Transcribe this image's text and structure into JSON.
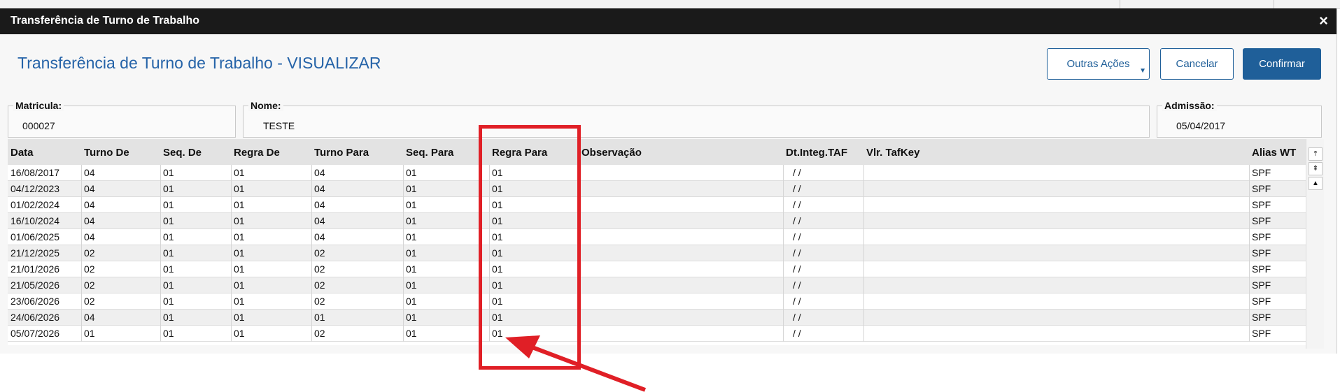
{
  "window": {
    "title": "Transferência de Turno de Trabalho",
    "close_glyph": "×"
  },
  "page": {
    "heading": "Transferência de Turno de Trabalho - VISUALIZAR"
  },
  "actions": {
    "other_label": "Outras Ações",
    "cancel_label": "Cancelar",
    "confirm_label": "Confirmar"
  },
  "fields": {
    "matricula": {
      "label": "Matricula:",
      "value": "000027"
    },
    "nome": {
      "label": "Nome:",
      "value": "TESTE"
    },
    "admissao": {
      "label": "Admissão:",
      "value": "05/04/2017"
    }
  },
  "table": {
    "columns": [
      "Data",
      "Turno De",
      "Seq. De",
      "Regra De",
      "Turno Para",
      "Seq. Para",
      "Regra Para",
      "Observação",
      "Dt.Integ.TAF",
      "Vlr. TafKey",
      "Alias WT"
    ],
    "rows": [
      [
        "16/08/2017",
        "04",
        "01",
        "01",
        "04",
        "01",
        "01",
        "",
        "/ /",
        "",
        "SPF"
      ],
      [
        "04/12/2023",
        "04",
        "01",
        "01",
        "04",
        "01",
        "01",
        "",
        "/ /",
        "",
        "SPF"
      ],
      [
        "01/02/2024",
        "04",
        "01",
        "01",
        "04",
        "01",
        "01",
        "",
        "/ /",
        "",
        "SPF"
      ],
      [
        "16/10/2024",
        "04",
        "01",
        "01",
        "04",
        "01",
        "01",
        "",
        "/ /",
        "",
        "SPF"
      ],
      [
        "01/06/2025",
        "04",
        "01",
        "01",
        "04",
        "01",
        "01",
        "",
        "/ /",
        "",
        "SPF"
      ],
      [
        "21/12/2025",
        "02",
        "01",
        "01",
        "02",
        "01",
        "01",
        "",
        "/ /",
        "",
        "SPF"
      ],
      [
        "21/01/2026",
        "02",
        "01",
        "01",
        "02",
        "01",
        "01",
        "",
        "/ /",
        "",
        "SPF"
      ],
      [
        "21/05/2026",
        "02",
        "01",
        "01",
        "02",
        "01",
        "01",
        "",
        "/ /",
        "",
        "SPF"
      ],
      [
        "23/06/2026",
        "02",
        "01",
        "01",
        "02",
        "01",
        "01",
        "",
        "/ /",
        "",
        "SPF"
      ],
      [
        "24/06/2026",
        "04",
        "01",
        "01",
        "01",
        "01",
        "01",
        "",
        "/ /",
        "",
        "SPF"
      ],
      [
        "05/07/2026",
        "01",
        "01",
        "01",
        "02",
        "01",
        "01",
        "",
        "/ /",
        "",
        "SPF"
      ]
    ]
  },
  "scrollbar": {
    "icons": [
      "scroll-first-icon",
      "scroll-page-up-icon",
      "scroll-up-icon"
    ],
    "glyphs": [
      "⤒",
      "⇞",
      "▲"
    ]
  },
  "annotation": {
    "color": "#e01f26"
  },
  "colors": {
    "accent": "#1f5f99",
    "heading": "#2563a8",
    "titlebar": "#1a1a1a",
    "row_alt": "#efefef"
  }
}
